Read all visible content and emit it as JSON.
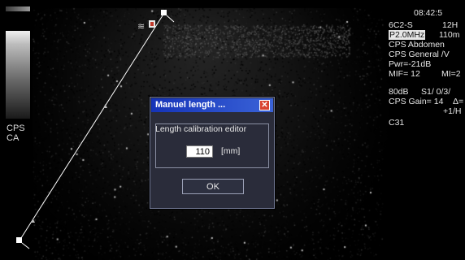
{
  "left_panel": {
    "labels": [
      "CPS",
      "CA"
    ]
  },
  "info_panel": {
    "time": "08:42:5",
    "probe": "6C2-S",
    "frame_rate": "12H",
    "frequency": "P2.0MHz",
    "depth": "110m",
    "exam": "CPS Abdomen",
    "preset": "CPS General /V",
    "power": "Pwr=-21dB",
    "mif": "MIF= 12",
    "mi": "MI=2",
    "dynamic_range": "80dB",
    "settings": "S1/ 0/3/",
    "gain": "CPS Gain= 14",
    "gain_delta": "Δ=",
    "persist": "+1/H",
    "code": "C31"
  },
  "dialog": {
    "title": "Manuel length ...",
    "close_glyph": "✕",
    "group_label": "Length calibration editor",
    "length_value": "110",
    "unit": "[mm]",
    "ok_label": "OK"
  },
  "measurement": {
    "icon_freeze": "≋",
    "colors": {
      "caliper_line": "#ffffff",
      "probe_icon": "#c0392b",
      "dialog_title": "#1533b8"
    }
  }
}
